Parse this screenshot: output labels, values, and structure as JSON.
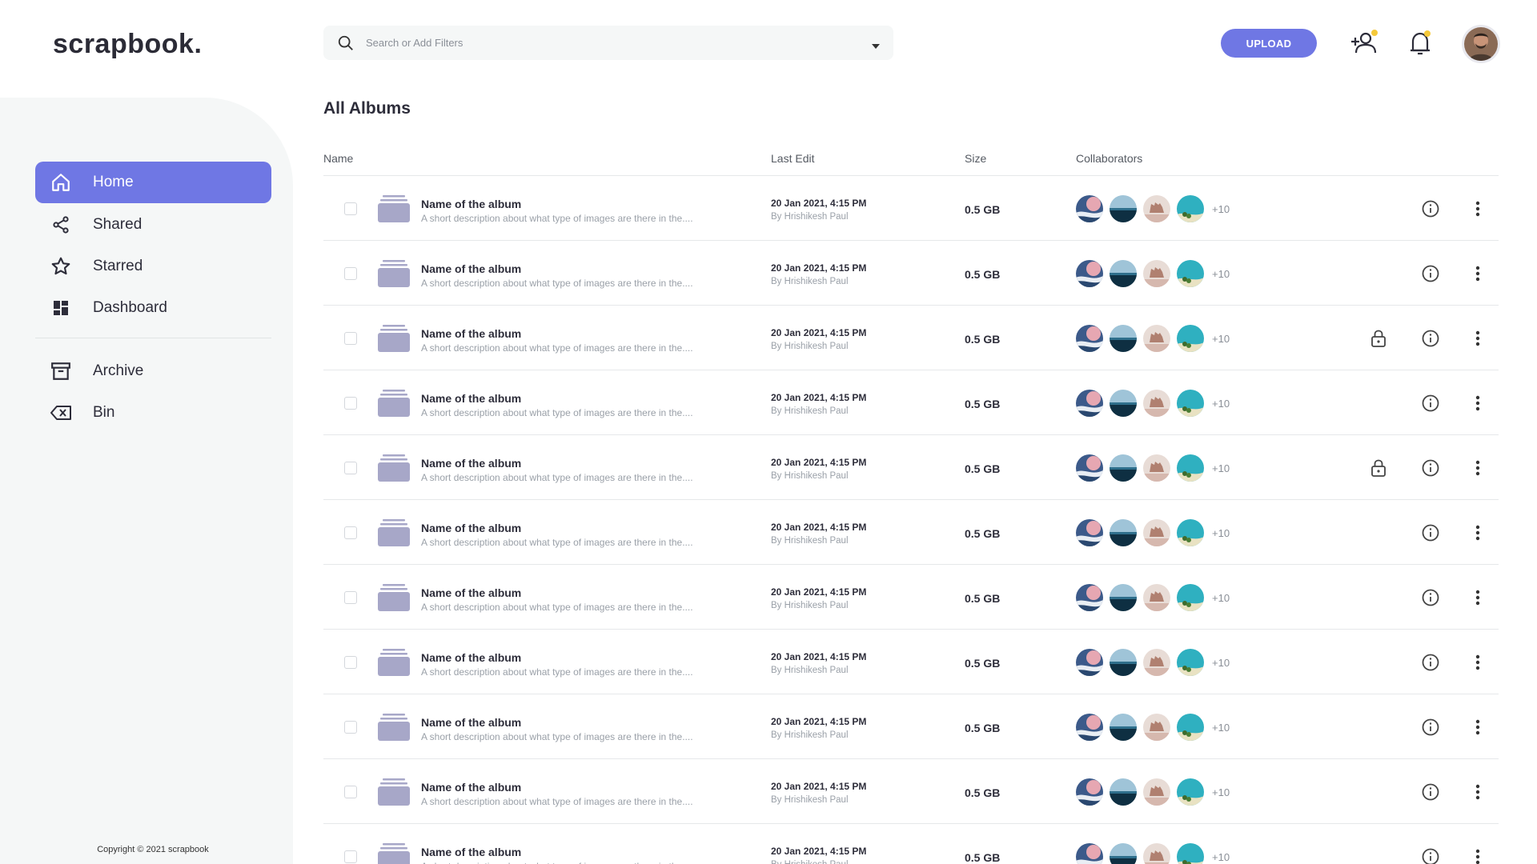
{
  "app": {
    "logo": "scrapbook."
  },
  "search": {
    "placeholder": "Search or Add Filters"
  },
  "header": {
    "upload_label": "UPLOAD"
  },
  "colors": {
    "accent": "#6f77e4",
    "sidebar_bg": "#f5f7f7",
    "badge": "#f5c93a"
  },
  "sidebar": {
    "items": [
      {
        "label": "Home",
        "icon": "home-icon",
        "active": true
      },
      {
        "label": "Shared",
        "icon": "share-icon",
        "active": false
      },
      {
        "label": "Starred",
        "icon": "star-icon",
        "active": false
      },
      {
        "label": "Dashboard",
        "icon": "dashboard-icon",
        "active": false
      },
      {
        "label": "Archive",
        "icon": "archive-icon",
        "active": false
      },
      {
        "label": "Bin",
        "icon": "bin-icon",
        "active": false
      }
    ],
    "copyright": "Copyright © 2021 scrapbook"
  },
  "main": {
    "title": "All Albums",
    "columns": {
      "name": "Name",
      "last_edit": "Last Edit",
      "size": "Size",
      "collaborators": "Collaborators"
    },
    "rows": [
      {
        "name": "Name of the album",
        "desc": "A short description about what type of images are there in the....",
        "date": "20 Jan 2021, 4:15 PM",
        "by": "By Hrishikesh Paul",
        "size": "0.5 GB",
        "more": "+10",
        "locked": false
      },
      {
        "name": "Name of the album",
        "desc": "A short description about what type of images are there in the....",
        "date": "20 Jan 2021, 4:15 PM",
        "by": "By Hrishikesh Paul",
        "size": "0.5 GB",
        "more": "+10",
        "locked": false
      },
      {
        "name": "Name of the album",
        "desc": "A short description about what type of images are there in the....",
        "date": "20 Jan 2021, 4:15 PM",
        "by": "By Hrishikesh Paul",
        "size": "0.5 GB",
        "more": "+10",
        "locked": true
      },
      {
        "name": "Name of the album",
        "desc": "A short description about what type of images are there in the....",
        "date": "20 Jan 2021, 4:15 PM",
        "by": "By Hrishikesh Paul",
        "size": "0.5 GB",
        "more": "+10",
        "locked": false
      },
      {
        "name": "Name of the album",
        "desc": "A short description about what type of images are there in the....",
        "date": "20 Jan 2021, 4:15 PM",
        "by": "By Hrishikesh Paul",
        "size": "0.5 GB",
        "more": "+10",
        "locked": true
      },
      {
        "name": "Name of the album",
        "desc": "A short description about what type of images are there in the....",
        "date": "20 Jan 2021, 4:15 PM",
        "by": "By Hrishikesh Paul",
        "size": "0.5 GB",
        "more": "+10",
        "locked": false
      },
      {
        "name": "Name of the album",
        "desc": "A short description about what type of images are there in the....",
        "date": "20 Jan 2021, 4:15 PM",
        "by": "By Hrishikesh Paul",
        "size": "0.5 GB",
        "more": "+10",
        "locked": false
      },
      {
        "name": "Name of the album",
        "desc": "A short description about what type of images are there in the....",
        "date": "20 Jan 2021, 4:15 PM",
        "by": "By Hrishikesh Paul",
        "size": "0.5 GB",
        "more": "+10",
        "locked": false
      },
      {
        "name": "Name of the album",
        "desc": "A short description about what type of images are there in the....",
        "date": "20 Jan 2021, 4:15 PM",
        "by": "By Hrishikesh Paul",
        "size": "0.5 GB",
        "more": "+10",
        "locked": false
      },
      {
        "name": "Name of the album",
        "desc": "A short description about what type of images are there in the....",
        "date": "20 Jan 2021, 4:15 PM",
        "by": "By Hrishikesh Paul",
        "size": "0.5 GB",
        "more": "+10",
        "locked": false
      },
      {
        "name": "Name of the album",
        "desc": "A short description about what type of images are there in the....",
        "date": "20 Jan 2021, 4:15 PM",
        "by": "By Hrishikesh Paul",
        "size": "0.5 GB",
        "more": "+10",
        "locked": false
      }
    ]
  }
}
